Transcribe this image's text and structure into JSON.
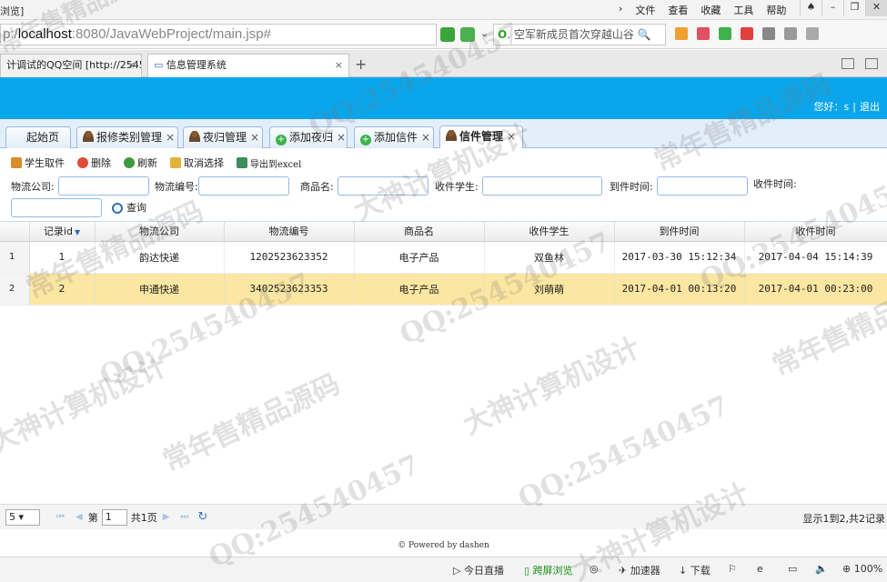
{
  "browser": {
    "left_fragment": "浏览]",
    "menus": [
      "文件",
      "查看",
      "收藏",
      "工具",
      "帮助"
    ],
    "url_prefix": "p:/",
    "url_host": "localhost",
    "url_rest": ":8080/JavaWebProject/main.jsp#",
    "search_text": "空军新成员首次穿越山谷",
    "tabs": [
      {
        "label": "计调试的QQ空间 [http://2545",
        "active": false
      },
      {
        "label": "信息管理系统",
        "active": true
      }
    ],
    "new_tab": "+"
  },
  "header": {
    "greeting": "您好：s",
    "logout": "退出"
  },
  "app_tabs": [
    {
      "label": "起始页",
      "icon": "none",
      "closable": false,
      "active": false
    },
    {
      "label": "报修类别管理",
      "icon": "person-icon",
      "closable": true,
      "active": false
    },
    {
      "label": "夜归管理",
      "icon": "person-icon",
      "closable": true,
      "active": false
    },
    {
      "label": "添加夜归",
      "icon": "plus-icon",
      "closable": true,
      "active": false
    },
    {
      "label": "添加信件",
      "icon": "plus-icon",
      "closable": true,
      "active": false
    },
    {
      "label": "信件管理",
      "icon": "person-icon",
      "closable": true,
      "active": true
    }
  ],
  "toolbar": {
    "receive": "学生取件",
    "delete": "删除",
    "refresh": "刷新",
    "cancel": "取消选择",
    "export": "导出到excel"
  },
  "filters": {
    "company": "物流公司:",
    "number": "物流编号:",
    "goods": "商品名:",
    "student": "收件学生:",
    "arrive": "到件时间:",
    "receive_time": "收件时间:",
    "query": "查询"
  },
  "grid": {
    "columns": [
      "记录id",
      "物流公司",
      "物流编号",
      "商品名",
      "收件学生",
      "到件时间",
      "收件时间"
    ],
    "rows": [
      {
        "rownum": "1",
        "id": "1",
        "company": "韵达快递",
        "number": "1202523623352",
        "goods": "电子产品",
        "student": "双鱼林",
        "arrive": "2017-03-30 15:12:34",
        "receive": "2017-04-04 15:14:39"
      },
      {
        "rownum": "2",
        "id": "2",
        "company": "申通快递",
        "number": "3402523623353",
        "goods": "电子产品",
        "student": "刘萌萌",
        "arrive": "2017-04-01 00:13:20",
        "receive": "2017-04-01 00:23:00"
      }
    ]
  },
  "pager": {
    "page_size": "5",
    "page_label": "第",
    "page_value": "1",
    "total_pages": "共1页",
    "info": "显示1到2,共2记录"
  },
  "footer": "© Powered by dashen",
  "statusbar": {
    "live": "今日直播",
    "cross": "跨屏浏览",
    "accel": "加速器",
    "download": "下载",
    "zoom": "100%"
  },
  "watermarks": [
    "QQ:254540457",
    "常年售精品源码",
    "大神计算机设计",
    "QQ:254540457",
    "常年售精品源码",
    "大神计算机设计",
    "QQ:254540457",
    "QQ:254540457",
    "常年售精品源码",
    "大神计算机设计",
    "QQ:254540457"
  ],
  "colors": {
    "header": "#0aa6ec",
    "selected_row": "#fbe6a2",
    "border": "#95b8e7"
  }
}
